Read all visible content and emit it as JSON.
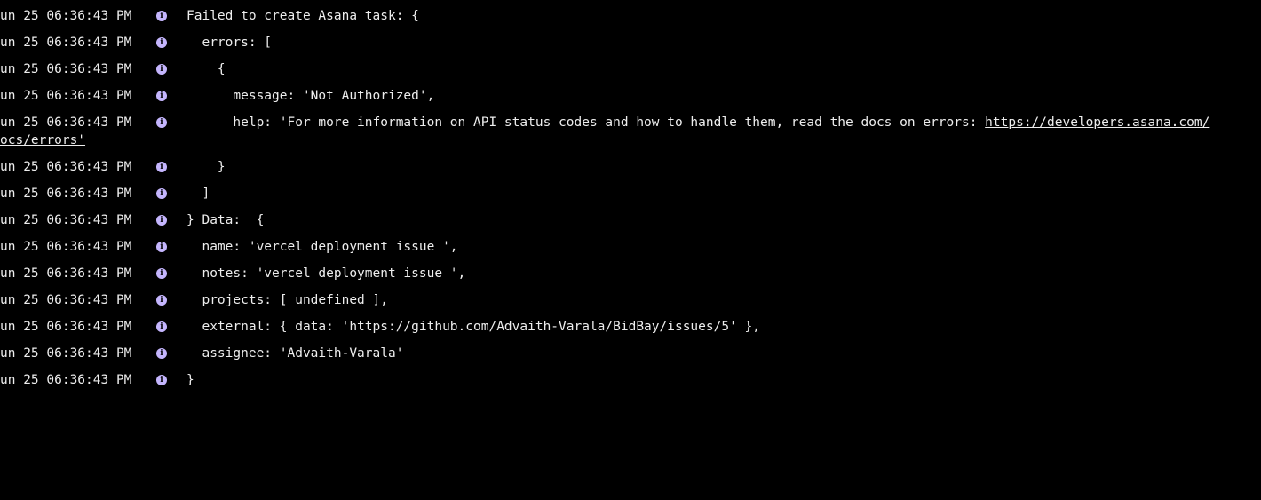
{
  "log": {
    "level_icon": "info-icon",
    "level_glyph": "i",
    "timestamp": "un 25 06:36:43 PM",
    "lines": [
      {
        "text": "Failed to create Asana task: {"
      },
      {
        "text": "  errors: ["
      },
      {
        "text": "    {"
      },
      {
        "text": "      message: 'Not Authorized',"
      },
      {
        "text": "      help: 'For more information on API status codes and how to handle them, read the docs on errors: ",
        "link": "https://developers.asana.com/",
        "continuation": "ocs/errors'"
      },
      {
        "text": "    }"
      },
      {
        "text": "  ]"
      },
      {
        "text": "} Data:  {"
      },
      {
        "text": "  name: 'vercel deployment issue ',"
      },
      {
        "text": "  notes: 'vercel deployment issue ',"
      },
      {
        "text": "  projects: [ undefined ],"
      },
      {
        "text": "  external: { data: 'https://github.com/Advaith-Varala/BidBay/issues/5' },"
      },
      {
        "text": "  assignee: 'Advaith-Varala'"
      },
      {
        "text": "}"
      }
    ]
  },
  "colors": {
    "background": "#000000",
    "text": "#ededed",
    "info_badge": "#c4b5fd"
  }
}
